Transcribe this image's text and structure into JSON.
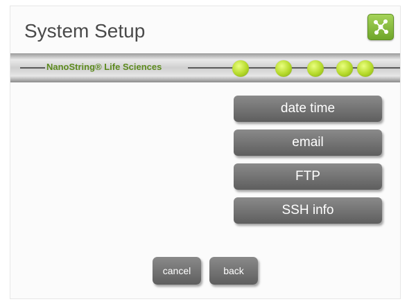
{
  "header": {
    "title": "System Setup",
    "logo_icon": "network-nodes-icon",
    "logo_color": "#8cc23f"
  },
  "banner": {
    "brand": "NanoString® Life Sciences",
    "brand_color": "#5c8a1e",
    "progress_dots": 5
  },
  "menu": {
    "items": [
      {
        "label": "date time"
      },
      {
        "label": "email"
      },
      {
        "label": "FTP"
      },
      {
        "label": "SSH info"
      }
    ]
  },
  "footer": {
    "cancel_label": "cancel",
    "back_label": "back"
  }
}
